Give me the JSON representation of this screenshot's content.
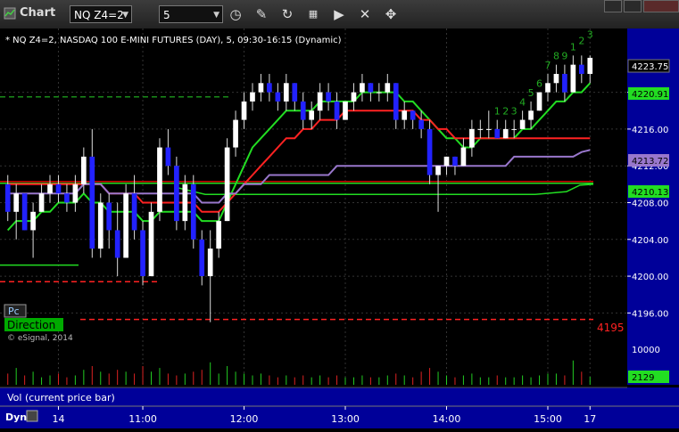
{
  "window": {
    "title": "Chart",
    "symbol": "NQ Z4=2",
    "interval": "5"
  },
  "toolbar": {
    "icons": [
      "clock-icon",
      "pencil-icon",
      "refresh-icon",
      "data-grid-icon",
      "play-icon",
      "close-icon",
      "move-icon"
    ]
  },
  "chart": {
    "description": "* NQ Z4=2, NASDAQ 100 E-MINI FUTURES (DAY), 5, 09:30-16:15 (Dynamic)",
    "copyright": "© eSignal, 2014",
    "pc_label": "Pc",
    "direction_label": "Direction",
    "level_label": "4195",
    "price_ticks": [
      "4220.0",
      "4216.00",
      "4212.00",
      "4208.00",
      "4204.00",
      "4200.00",
      "4196.00"
    ],
    "price_badges": {
      "last": "4223.75",
      "green_ma": "4220.91",
      "purple_ma": "4213.72",
      "green_band": "4210.13"
    },
    "volume_ticks": [
      "10000"
    ],
    "volume_badge": "2129",
    "volume_label": "Vol (current price bar)",
    "time_ticks": [
      "14",
      "11:00",
      "12:00",
      "13:00",
      "14:00",
      "15:00",
      "17"
    ],
    "dyn_label": "Dyn",
    "td_counts": [
      "1",
      "2",
      "3",
      "4",
      "5",
      "6",
      "7",
      "8",
      "9",
      "1",
      "2",
      "3"
    ],
    "colors": {
      "up": "#ffffff",
      "down": "#2222ff",
      "green_ma": "#22dd22",
      "red_ma": "#ff2222",
      "purple_ma": "#9977cc",
      "axis_bg": "#000099"
    }
  },
  "chart_data": {
    "type": "line",
    "y_range": [
      4194,
      4225
    ],
    "candles": [
      {
        "o": 4210,
        "h": 4211,
        "l": 4206,
        "c": 4207
      },
      {
        "o": 4207,
        "h": 4210,
        "l": 4204,
        "c": 4209
      },
      {
        "o": 4209,
        "h": 4209,
        "l": 4205,
        "c": 4205
      },
      {
        "o": 4205,
        "h": 4208,
        "l": 4202,
        "c": 4207
      },
      {
        "o": 4207,
        "h": 4210,
        "l": 4207,
        "c": 4209
      },
      {
        "o": 4209,
        "h": 4211,
        "l": 4208,
        "c": 4210
      },
      {
        "o": 4210,
        "h": 4211,
        "l": 4208,
        "c": 4209
      },
      {
        "o": 4209,
        "h": 4210,
        "l": 4207,
        "c": 4208
      },
      {
        "o": 4208,
        "h": 4211,
        "l": 4207,
        "c": 4210
      },
      {
        "o": 4210,
        "h": 4214,
        "l": 4209,
        "c": 4213
      },
      {
        "o": 4213,
        "h": 4216,
        "l": 4202,
        "c": 4203
      },
      {
        "o": 4203,
        "h": 4209,
        "l": 4202,
        "c": 4208
      },
      {
        "o": 4208,
        "h": 4209,
        "l": 4203,
        "c": 4205
      },
      {
        "o": 4205,
        "h": 4208,
        "l": 4200,
        "c": 4202
      },
      {
        "o": 4202,
        "h": 4210,
        "l": 4202,
        "c": 4209
      },
      {
        "o": 4209,
        "h": 4211,
        "l": 4204,
        "c": 4205
      },
      {
        "o": 4205,
        "h": 4206,
        "l": 4199,
        "c": 4200
      },
      {
        "o": 4200,
        "h": 4208,
        "l": 4200,
        "c": 4207
      },
      {
        "o": 4207,
        "h": 4215,
        "l": 4206,
        "c": 4214
      },
      {
        "o": 4214,
        "h": 4216,
        "l": 4211,
        "c": 4212
      },
      {
        "o": 4212,
        "h": 4213,
        "l": 4205,
        "c": 4206
      },
      {
        "o": 4206,
        "h": 4211,
        "l": 4205,
        "c": 4210
      },
      {
        "o": 4210,
        "h": 4211,
        "l": 4203,
        "c": 4204
      },
      {
        "o": 4204,
        "h": 4205,
        "l": 4199,
        "c": 4200
      },
      {
        "o": 4200,
        "h": 4205,
        "l": 4195,
        "c": 4203
      },
      {
        "o": 4203,
        "h": 4207,
        "l": 4202,
        "c": 4206
      },
      {
        "o": 4206,
        "h": 4215,
        "l": 4206,
        "c": 4214
      },
      {
        "o": 4214,
        "h": 4218,
        "l": 4213,
        "c": 4217
      },
      {
        "o": 4217,
        "h": 4220,
        "l": 4216,
        "c": 4219
      },
      {
        "o": 4219,
        "h": 4221,
        "l": 4218,
        "c": 4220
      },
      {
        "o": 4220,
        "h": 4222,
        "l": 4219,
        "c": 4221
      },
      {
        "o": 4221,
        "h": 4222,
        "l": 4219,
        "c": 4220
      },
      {
        "o": 4220,
        "h": 4221,
        "l": 4218,
        "c": 4219
      },
      {
        "o": 4219,
        "h": 4222,
        "l": 4218,
        "c": 4221
      },
      {
        "o": 4221,
        "h": 4221,
        "l": 4218,
        "c": 4219
      },
      {
        "o": 4219,
        "h": 4220,
        "l": 4216,
        "c": 4217
      },
      {
        "o": 4217,
        "h": 4219,
        "l": 4216,
        "c": 4218
      },
      {
        "o": 4218,
        "h": 4221,
        "l": 4217,
        "c": 4220
      },
      {
        "o": 4220,
        "h": 4221,
        "l": 4218,
        "c": 4219
      },
      {
        "o": 4219,
        "h": 4220,
        "l": 4216,
        "c": 4217
      },
      {
        "o": 4217,
        "h": 4219,
        "l": 4217,
        "c": 4219
      },
      {
        "o": 4219,
        "h": 4221,
        "l": 4218,
        "c": 4220
      },
      {
        "o": 4220,
        "h": 4222,
        "l": 4219,
        "c": 4221
      },
      {
        "o": 4221,
        "h": 4221,
        "l": 4219,
        "c": 4220
      },
      {
        "o": 4220,
        "h": 4221,
        "l": 4219,
        "c": 4220
      },
      {
        "o": 4220,
        "h": 4222,
        "l": 4219,
        "c": 4221
      },
      {
        "o": 4221,
        "h": 4221,
        "l": 4216,
        "c": 4217
      },
      {
        "o": 4217,
        "h": 4219,
        "l": 4216,
        "c": 4218
      },
      {
        "o": 4218,
        "h": 4218,
        "l": 4216,
        "c": 4217
      },
      {
        "o": 4217,
        "h": 4218,
        "l": 4215,
        "c": 4216
      },
      {
        "o": 4216,
        "h": 4217,
        "l": 4210,
        "c": 4211
      },
      {
        "o": 4211,
        "h": 4212,
        "l": 4207,
        "c": 4212
      },
      {
        "o": 4212,
        "h": 4213,
        "l": 4211,
        "c": 4213
      },
      {
        "o": 4213,
        "h": 4213,
        "l": 4211,
        "c": 4212
      },
      {
        "o": 4212,
        "h": 4215,
        "l": 4212,
        "c": 4214
      },
      {
        "o": 4214,
        "h": 4217,
        "l": 4213,
        "c": 4216
      },
      {
        "o": 4216,
        "h": 4217,
        "l": 4215,
        "c": 4216
      },
      {
        "o": 4216,
        "h": 4218,
        "l": 4215,
        "c": 4216
      },
      {
        "o": 4216,
        "h": 4217,
        "l": 4215,
        "c": 4215
      },
      {
        "o": 4215,
        "h": 4217,
        "l": 4215,
        "c": 4216
      },
      {
        "o": 4216,
        "h": 4217,
        "l": 4215,
        "c": 4216
      },
      {
        "o": 4216,
        "h": 4218,
        "l": 4216,
        "c": 4217
      },
      {
        "o": 4217,
        "h": 4219,
        "l": 4216,
        "c": 4218
      },
      {
        "o": 4218,
        "h": 4220,
        "l": 4218,
        "c": 4220
      },
      {
        "o": 4220,
        "h": 4222,
        "l": 4219,
        "c": 4221
      },
      {
        "o": 4221,
        "h": 4223,
        "l": 4220,
        "c": 4222
      },
      {
        "o": 4222,
        "h": 4223,
        "l": 4219,
        "c": 4220
      },
      {
        "o": 4220,
        "h": 4224,
        "l": 4220,
        "c": 4223
      },
      {
        "o": 4223,
        "h": 4224,
        "l": 4221,
        "c": 4222
      },
      {
        "o": 4222,
        "h": 4224,
        "l": 4221,
        "c": 4223.75
      }
    ],
    "series": [
      {
        "name": "green_ma",
        "values": [
          4205,
          4206,
          4206,
          4206,
          4207,
          4207,
          4208,
          4208,
          4208,
          4209,
          4208,
          4208,
          4207,
          4207,
          4207,
          4207,
          4206,
          4206,
          4207,
          4207,
          4207,
          4207,
          4207,
          4206,
          4206,
          4206,
          4208,
          4210,
          4212,
          4214,
          4215,
          4216,
          4217,
          4218,
          4218,
          4218,
          4218,
          4219,
          4219,
          4219,
          4219,
          4219,
          4220,
          4220,
          4220,
          4220,
          4220,
          4219,
          4219,
          4218,
          4217,
          4216,
          4215,
          4215,
          4214,
          4214,
          4215,
          4215,
          4215,
          4215,
          4215,
          4216,
          4216,
          4217,
          4218,
          4219,
          4219,
          4220,
          4220,
          4221
        ]
      },
      {
        "name": "red_ma",
        "values": [
          4210,
          4210,
          4210,
          4210,
          4210,
          4210,
          4210,
          4210,
          4210,
          4210,
          4210,
          4210,
          4209,
          4209,
          4209,
          4209,
          4208,
          4208,
          4208,
          4208,
          4208,
          4208,
          4208,
          4207,
          4207,
          4207,
          4208,
          4209,
          4210,
          4211,
          4212,
          4213,
          4214,
          4215,
          4215,
          4216,
          4216,
          4217,
          4217,
          4217,
          4218,
          4218,
          4218,
          4218,
          4218,
          4218,
          4218,
          4218,
          4218,
          4217,
          4217,
          4216,
          4216,
          4215,
          4215,
          4215,
          4215,
          4215,
          4215,
          4215,
          4215,
          4215,
          4215,
          4215,
          4215,
          4215,
          4215,
          4215,
          4215,
          4215
        ]
      },
      {
        "name": "purple_ma",
        "values": [
          4209,
          4209,
          4209,
          4209,
          4209,
          4209,
          4209,
          4209,
          4209,
          4210,
          4210,
          4210,
          4209,
          4209,
          4209,
          4209,
          4209,
          4209,
          4209,
          4209,
          4209,
          4209,
          4209,
          4208,
          4208,
          4208,
          4209,
          4209,
          4210,
          4210,
          4210,
          4211,
          4211,
          4211,
          4211,
          4211,
          4211,
          4211,
          4211,
          4212,
          4212,
          4212,
          4212,
          4212,
          4212,
          4212,
          4212,
          4212,
          4212,
          4212,
          4212,
          4212,
          4212,
          4212,
          4212,
          4212,
          4212,
          4212,
          4212,
          4212,
          4213,
          4213,
          4213,
          4213,
          4213,
          4213,
          4213,
          4213,
          4213.5,
          4213.72
        ]
      }
    ],
    "volume": [
      3000,
      4500,
      2500,
      3500,
      2000,
      2500,
      3000,
      2000,
      2500,
      4000,
      5000,
      3500,
      3000,
      4000,
      3500,
      3000,
      5000,
      3500,
      4500,
      3000,
      2500,
      3000,
      3500,
      4000,
      6000,
      3000,
      5000,
      3500,
      3000,
      2500,
      3000,
      2500,
      2000,
      2500,
      2000,
      2500,
      2000,
      2500,
      2000,
      2500,
      2000,
      2000,
      2500,
      2000,
      2000,
      2500,
      3000,
      2500,
      2000,
      3500,
      4500,
      3500,
      2500,
      2000,
      2500,
      3000,
      2000,
      2000,
      2500,
      2000,
      2000,
      2500,
      2000,
      2500,
      3000,
      3000,
      2500,
      6500,
      3500,
      2129
    ],
    "volume_range": [
      0,
      10000
    ]
  }
}
